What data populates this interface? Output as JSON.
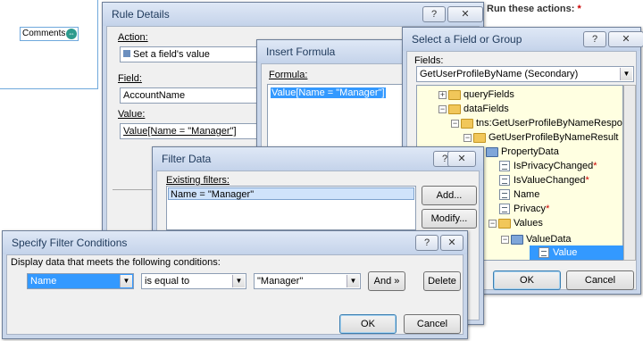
{
  "background_form": {
    "comments_label": "Comments",
    "comments_icon": "circle-arrow-icon",
    "run_actions_label": "Run these actions:",
    "run_actions_required": "*"
  },
  "rule_details": {
    "title": "Rule Details",
    "help": "?",
    "close": "✕",
    "action_label": "Action:",
    "action_value": "Set a field's value",
    "field_label": "Field:",
    "field_value": "AccountName",
    "value_label": "Value:",
    "value_value": "Value[Name = \"Manager\"]"
  },
  "insert_formula": {
    "title": "Insert Formula",
    "formula_label": "Formula:",
    "formula_value": "Value[Name = \"Manager\"]"
  },
  "select_field": {
    "title": "Select a Field or Group",
    "help": "?",
    "close": "✕",
    "fields_label": "Fields:",
    "data_source": "GetUserProfileByName (Secondary)",
    "tree": [
      {
        "label": "queryFields",
        "toggle": "+",
        "kind": "folder"
      },
      {
        "label": "dataFields",
        "toggle": "−",
        "kind": "folder"
      },
      {
        "label": "tns:GetUserProfileByNameResponse",
        "toggle": "−",
        "kind": "folder"
      },
      {
        "label": "GetUserProfileByNameResult",
        "toggle": "−",
        "kind": "folder"
      },
      {
        "label": "PropertyData",
        "toggle": "−",
        "kind": "group"
      },
      {
        "label": "IsPrivacyChanged",
        "kind": "field",
        "required": "*"
      },
      {
        "label": "IsValueChanged",
        "kind": "field",
        "required": "*"
      },
      {
        "label": "Name",
        "kind": "field"
      },
      {
        "label": "Privacy",
        "kind": "field",
        "required": "*"
      },
      {
        "label": "Values",
        "toggle": "−",
        "kind": "folder"
      },
      {
        "label": "ValueData",
        "toggle": "−",
        "kind": "group"
      },
      {
        "label": "Value",
        "kind": "field",
        "selected": true
      }
    ],
    "ok": "OK",
    "cancel": "Cancel"
  },
  "filter_data": {
    "title": "Filter Data",
    "help": "?",
    "close": "✕",
    "existing_label": "Existing filters:",
    "filters": [
      "Name = \"Manager\""
    ],
    "add": "Add...",
    "modify": "Modify..."
  },
  "specify_filter": {
    "title": "Specify Filter Conditions",
    "help": "?",
    "close": "✕",
    "instruction": "Display data that meets the following conditions:",
    "field_value": "Name",
    "operator_value": "is equal to",
    "compare_value": "\"Manager\"",
    "and_button": "And »",
    "delete_button": "Delete",
    "ok": "OK",
    "cancel": "Cancel"
  },
  "colors": {
    "selection": "#3399ff",
    "tree_background": "#ffffe1",
    "title_text": "#1e395b"
  }
}
